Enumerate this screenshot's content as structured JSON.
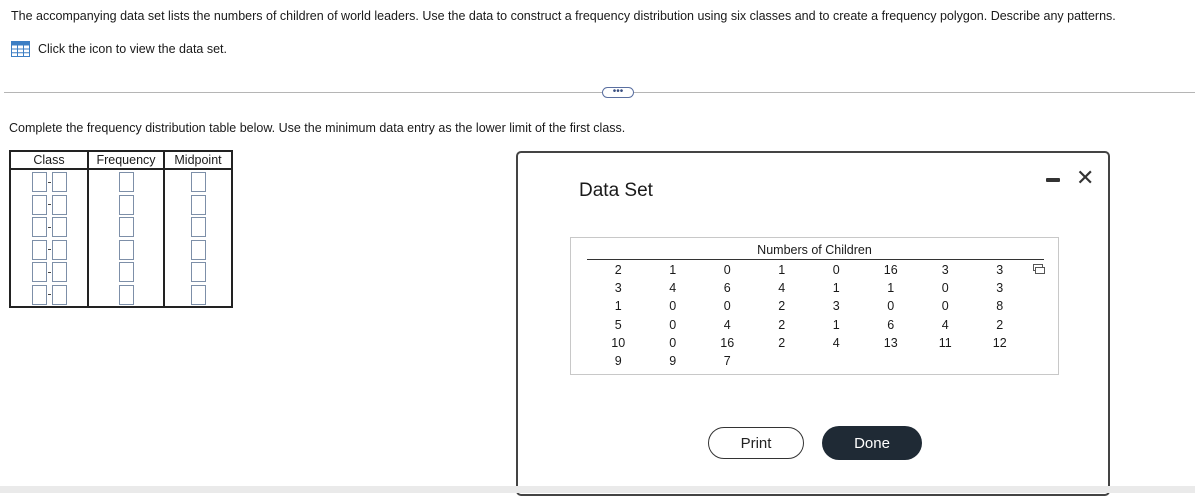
{
  "question": {
    "text": "The accompanying data set lists the numbers of children of world leaders. Use the data to construct a frequency distribution using six classes and to create a frequency polygon. Describe any patterns.",
    "dataset_link": "Click the icon to view the data set.",
    "more_button": "•••"
  },
  "instruction": "Complete the frequency distribution table below. Use the minimum data entry as the lower limit of the first class.",
  "freq_table": {
    "headers": [
      "Class",
      "Frequency",
      "Midpoint"
    ],
    "rows": 6
  },
  "dialog": {
    "title": "Data Set",
    "dataset_header": "Numbers of Children",
    "rows": [
      [
        "2",
        "1",
        "0",
        "1",
        "0",
        "16",
        "3",
        "3"
      ],
      [
        "3",
        "4",
        "6",
        "4",
        "1",
        "1",
        "0",
        "3"
      ],
      [
        "1",
        "0",
        "0",
        "2",
        "3",
        "0",
        "0",
        "8"
      ],
      [
        "5",
        "0",
        "4",
        "2",
        "1",
        "6",
        "4",
        "2"
      ],
      [
        "10",
        "0",
        "16",
        "2",
        "4",
        "13",
        "11",
        "12"
      ],
      [
        "9",
        "9",
        "7",
        "",
        "",
        "",
        "",
        ""
      ]
    ],
    "print_label": "Print",
    "done_label": "Done"
  }
}
